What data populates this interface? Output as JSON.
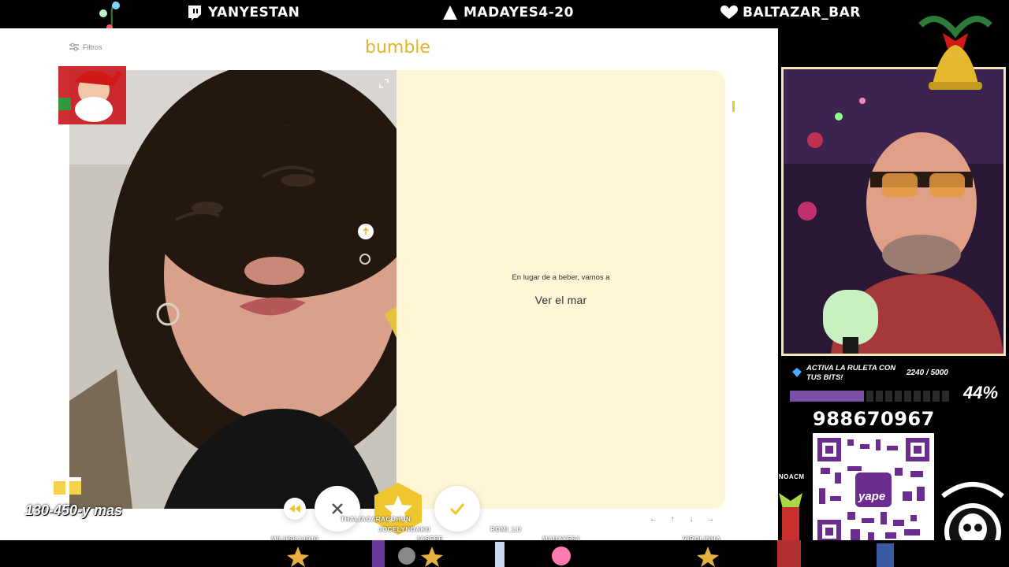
{
  "top_bar": {
    "socials": [
      {
        "icon": "twitch-icon",
        "label": "YANYESTAN"
      },
      {
        "icon": "kick-icon",
        "label": "MADAYES4-20"
      },
      {
        "icon": "heart-icon",
        "label": "BALTAZAR_BAR"
      }
    ]
  },
  "app": {
    "brand": "bumble",
    "filters_label": "Filtros",
    "prompt_question": "En lugar de a beber, vamos a",
    "prompt_answer": "Ver el mar",
    "accent_color": "#f0c630",
    "card_bg_color": "#fef6d6"
  },
  "stream": {
    "goal_title": "ACTIVA LA RULETA CON TUS BITS!",
    "goal_count": "2240 / 5000",
    "goal_percent_label": "44%",
    "goal_fraction": 0.44,
    "phone": "988670967",
    "qr_brand": "yape",
    "sponsor_label": "BRUNOACM",
    "promo_text": "130-450-y mas",
    "chat_names": [
      "THALIACARACOHUN",
      "JOCELYNOAKU",
      "MILUSKA1910",
      "JASFEE",
      "ROMI_LU",
      "MADAYES4",
      "VIROLINHA"
    ]
  }
}
